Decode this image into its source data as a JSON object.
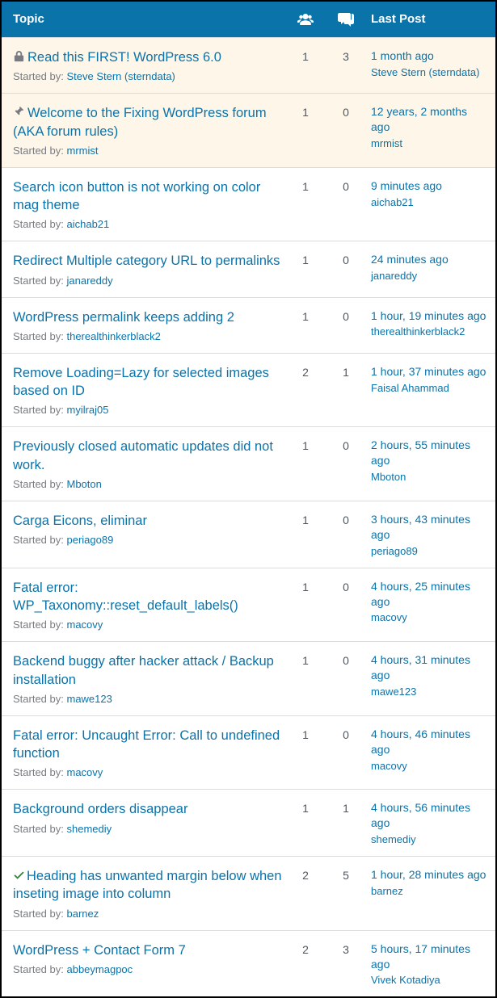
{
  "header": {
    "topic_label": "Topic",
    "last_post_label": "Last Post"
  },
  "labels": {
    "started_by": "Started by: "
  },
  "topics": [
    {
      "status": "locked",
      "sticky": true,
      "title": "Read this FIRST! WordPress 6.0",
      "author": "Steve Stern (sterndata)",
      "voices": "1",
      "replies": "3",
      "last_time": "1 month ago",
      "last_author": "Steve Stern (sterndata)"
    },
    {
      "status": "pinned",
      "sticky": true,
      "title": "Welcome to the Fixing WordPress forum (AKA forum rules)",
      "author": "mrmist",
      "voices": "1",
      "replies": "0",
      "last_time": "12 years, 2 months ago",
      "last_author": "mrmist"
    },
    {
      "status": "none",
      "sticky": false,
      "title": "Search icon button is not working on color mag theme",
      "author": "aichab21",
      "voices": "1",
      "replies": "0",
      "last_time": "9 minutes ago",
      "last_author": "aichab21"
    },
    {
      "status": "none",
      "sticky": false,
      "title": "Redirect Multiple category URL to permalinks",
      "author": "janareddy",
      "voices": "1",
      "replies": "0",
      "last_time": "24 minutes ago",
      "last_author": "janareddy"
    },
    {
      "status": "none",
      "sticky": false,
      "title": "WordPress permalink keeps adding 2",
      "author": "therealthinkerblack2",
      "voices": "1",
      "replies": "0",
      "last_time": "1 hour, 19 minutes ago",
      "last_author": "therealthinkerblack2"
    },
    {
      "status": "none",
      "sticky": false,
      "title": "Remove Loading=Lazy for selected images based on ID",
      "author": "myilraj05",
      "voices": "2",
      "replies": "1",
      "last_time": "1 hour, 37 minutes ago",
      "last_author": "Faisal Ahammad"
    },
    {
      "status": "none",
      "sticky": false,
      "title": "Previously closed automatic updates did not work.",
      "author": "Mboton",
      "voices": "1",
      "replies": "0",
      "last_time": "2 hours, 55 minutes ago",
      "last_author": "Mboton"
    },
    {
      "status": "none",
      "sticky": false,
      "title": "Carga Eicons, eliminar",
      "author": "periago89",
      "voices": "1",
      "replies": "0",
      "last_time": "3 hours, 43 minutes ago",
      "last_author": "periago89"
    },
    {
      "status": "none",
      "sticky": false,
      "title": "Fatal error: WP_Taxonomy::reset_default_labels()",
      "author": "macovy",
      "voices": "1",
      "replies": "0",
      "last_time": "4 hours, 25 minutes ago",
      "last_author": "macovy"
    },
    {
      "status": "none",
      "sticky": false,
      "title": "Backend buggy after hacker attack / Backup installation",
      "author": "mawe123",
      "voices": "1",
      "replies": "0",
      "last_time": "4 hours, 31 minutes ago",
      "last_author": "mawe123"
    },
    {
      "status": "none",
      "sticky": false,
      "title": "Fatal error: Uncaught Error: Call to undefined function",
      "author": "macovy",
      "voices": "1",
      "replies": "0",
      "last_time": "4 hours, 46 minutes ago",
      "last_author": "macovy"
    },
    {
      "status": "none",
      "sticky": false,
      "title": "Background orders disappear",
      "author": "shemediy",
      "voices": "1",
      "replies": "1",
      "last_time": "4 hours, 56 minutes ago",
      "last_author": "shemediy"
    },
    {
      "status": "resolved",
      "sticky": false,
      "title": "Heading has unwanted margin below when inseting image into column",
      "author": "barnez",
      "voices": "2",
      "replies": "5",
      "last_time": "1 hour, 28 minutes ago",
      "last_author": "barnez"
    },
    {
      "status": "none",
      "sticky": false,
      "title": "WordPress + Contact Form 7",
      "author": "abbeymagpoc",
      "voices": "2",
      "replies": "3",
      "last_time": "5 hours, 17 minutes ago",
      "last_author": "Vivek Kotadiya"
    }
  ]
}
